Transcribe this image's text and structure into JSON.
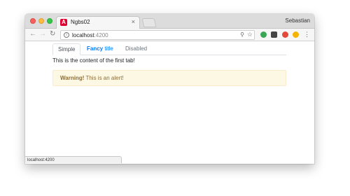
{
  "browser": {
    "tab_title": "Ngbs02",
    "tab_close": "×",
    "profile_name": "Sebastian",
    "url_host": "localhost",
    "url_port": ":4200",
    "status_url": "localhost:4200"
  },
  "page": {
    "tabs": [
      {
        "label": "Simple"
      },
      {
        "label_bold": "Fancy",
        "label_rest": " title"
      },
      {
        "label": "Disabled"
      }
    ],
    "content": "This is the content of the first tab!",
    "alert": {
      "strong": "Warning!",
      "text": " This is an alert!"
    }
  },
  "colors": {
    "accent": "#007bff",
    "alert_bg": "#fcf8e3",
    "alert_text": "#8a6d3b"
  }
}
